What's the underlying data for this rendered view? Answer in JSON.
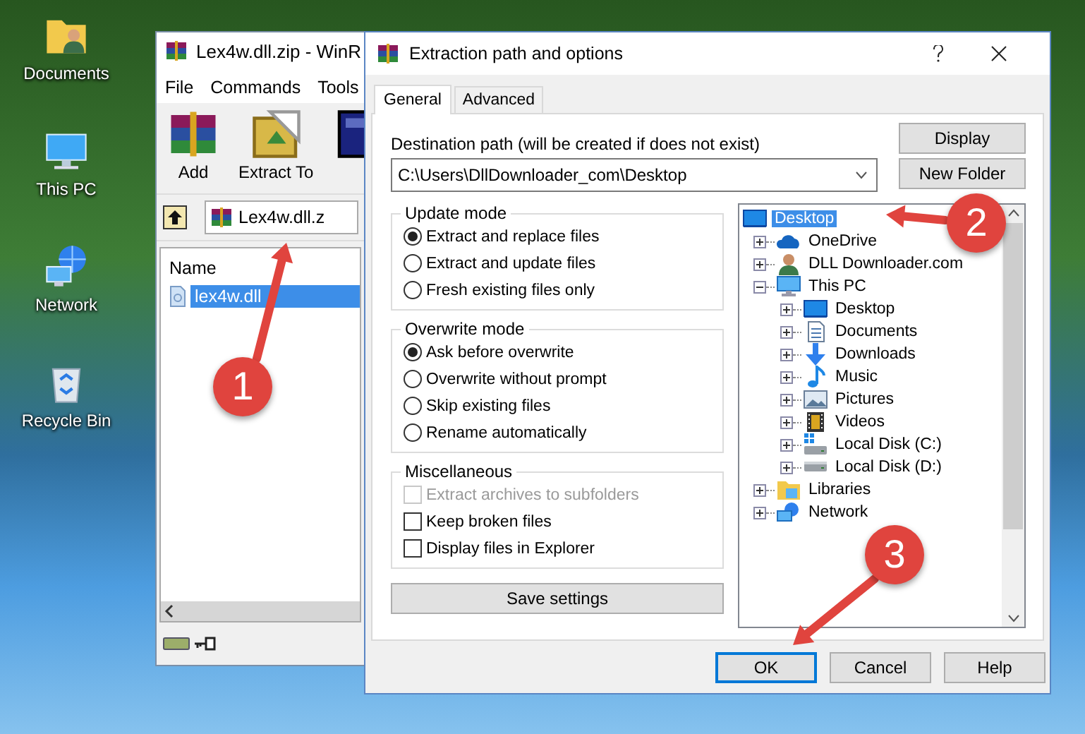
{
  "desktop_icons": [
    {
      "label": "Documents",
      "kind": "documents"
    },
    {
      "label": "This PC",
      "kind": "pc"
    },
    {
      "label": "Network",
      "kind": "network"
    },
    {
      "label": "Recycle Bin",
      "kind": "recycle-bin"
    }
  ],
  "archive_window": {
    "title": "Lex4w.dll.zip - WinR",
    "menu": [
      "File",
      "Commands",
      "Tools"
    ],
    "toolbar": [
      {
        "label": "Add",
        "kind": "archive"
      },
      {
        "label": "Extract To",
        "kind": "extract"
      },
      {
        "kind": "book"
      }
    ],
    "path": "Lex4w.dll.z",
    "columns": [
      "Name"
    ],
    "files": [
      {
        "name": "lex4w.dll",
        "selected": true
      }
    ]
  },
  "dialog": {
    "title": "Extraction path and options",
    "tabs": [
      {
        "label": "General",
        "selected": true
      },
      {
        "label": "Advanced",
        "selected": false
      }
    ],
    "destination_label": "Destination path (will be created if does not exist)",
    "destination": "C:\\Users\\DllDownloader_com\\Desktop",
    "side_buttons": [
      "Display",
      "New Folder"
    ],
    "groups": [
      {
        "title": "Update mode",
        "options": [
          {
            "label": "Extract and replace files",
            "kind": "radio",
            "selected": true
          },
          {
            "label": "Extract and update files",
            "kind": "radio",
            "selected": false
          },
          {
            "label": "Fresh existing files only",
            "kind": "radio",
            "selected": false
          }
        ]
      },
      {
        "title": "Overwrite mode",
        "options": [
          {
            "label": "Ask before overwrite",
            "kind": "radio",
            "selected": true
          },
          {
            "label": "Overwrite without prompt",
            "kind": "radio",
            "selected": false
          },
          {
            "label": "Skip existing files",
            "kind": "radio",
            "selected": false
          },
          {
            "label": "Rename automatically",
            "kind": "radio",
            "selected": false
          }
        ]
      },
      {
        "title": "Miscellaneous",
        "options": [
          {
            "label": "Extract archives to subfolders",
            "kind": "checkbox",
            "checked": false,
            "disabled": true
          },
          {
            "label": "Keep broken files",
            "kind": "checkbox",
            "checked": false,
            "disabled": false
          },
          {
            "label": "Display files in Explorer",
            "kind": "checkbox",
            "checked": false,
            "disabled": false
          }
        ]
      }
    ],
    "save_button": "Save settings",
    "tree": [
      {
        "label": "Desktop",
        "kind": "desktop",
        "selected": true,
        "children": [
          {
            "label": "OneDrive",
            "kind": "cloud",
            "selected": false,
            "expanded": false
          },
          {
            "label": "DLL Downloader.com",
            "kind": "person",
            "selected": false,
            "expanded": false
          },
          {
            "label": "This PC",
            "kind": "pc",
            "selected": false,
            "expanded": true,
            "children": [
              {
                "label": "Desktop",
                "kind": "desktop",
                "selected": false,
                "expanded": false
              },
              {
                "label": "Documents",
                "kind": "document",
                "selected": false,
                "expanded": false
              },
              {
                "label": "Downloads",
                "kind": "download",
                "selected": false,
                "expanded": false
              },
              {
                "label": "Music",
                "kind": "music",
                "selected": false,
                "expanded": false
              },
              {
                "label": "Pictures",
                "kind": "picture",
                "selected": false,
                "expanded": false
              },
              {
                "label": "Videos",
                "kind": "video",
                "selected": false,
                "expanded": false
              },
              {
                "label": "Local Disk (C:)",
                "kind": "disk-system",
                "selected": false,
                "expanded": false
              },
              {
                "label": "Local Disk (D:)",
                "kind": "disk",
                "selected": false,
                "expanded": false
              }
            ]
          },
          {
            "label": "Libraries",
            "kind": "library",
            "selected": false,
            "expanded": false
          },
          {
            "label": "Network",
            "kind": "network",
            "selected": false,
            "expanded": false
          }
        ]
      }
    ],
    "buttons": [
      {
        "label": "OK",
        "default": true
      },
      {
        "label": "Cancel",
        "default": false
      },
      {
        "label": "Help",
        "default": false
      }
    ]
  },
  "annotations": [
    {
      "number": "1"
    },
    {
      "number": "2"
    },
    {
      "number": "3"
    }
  ]
}
